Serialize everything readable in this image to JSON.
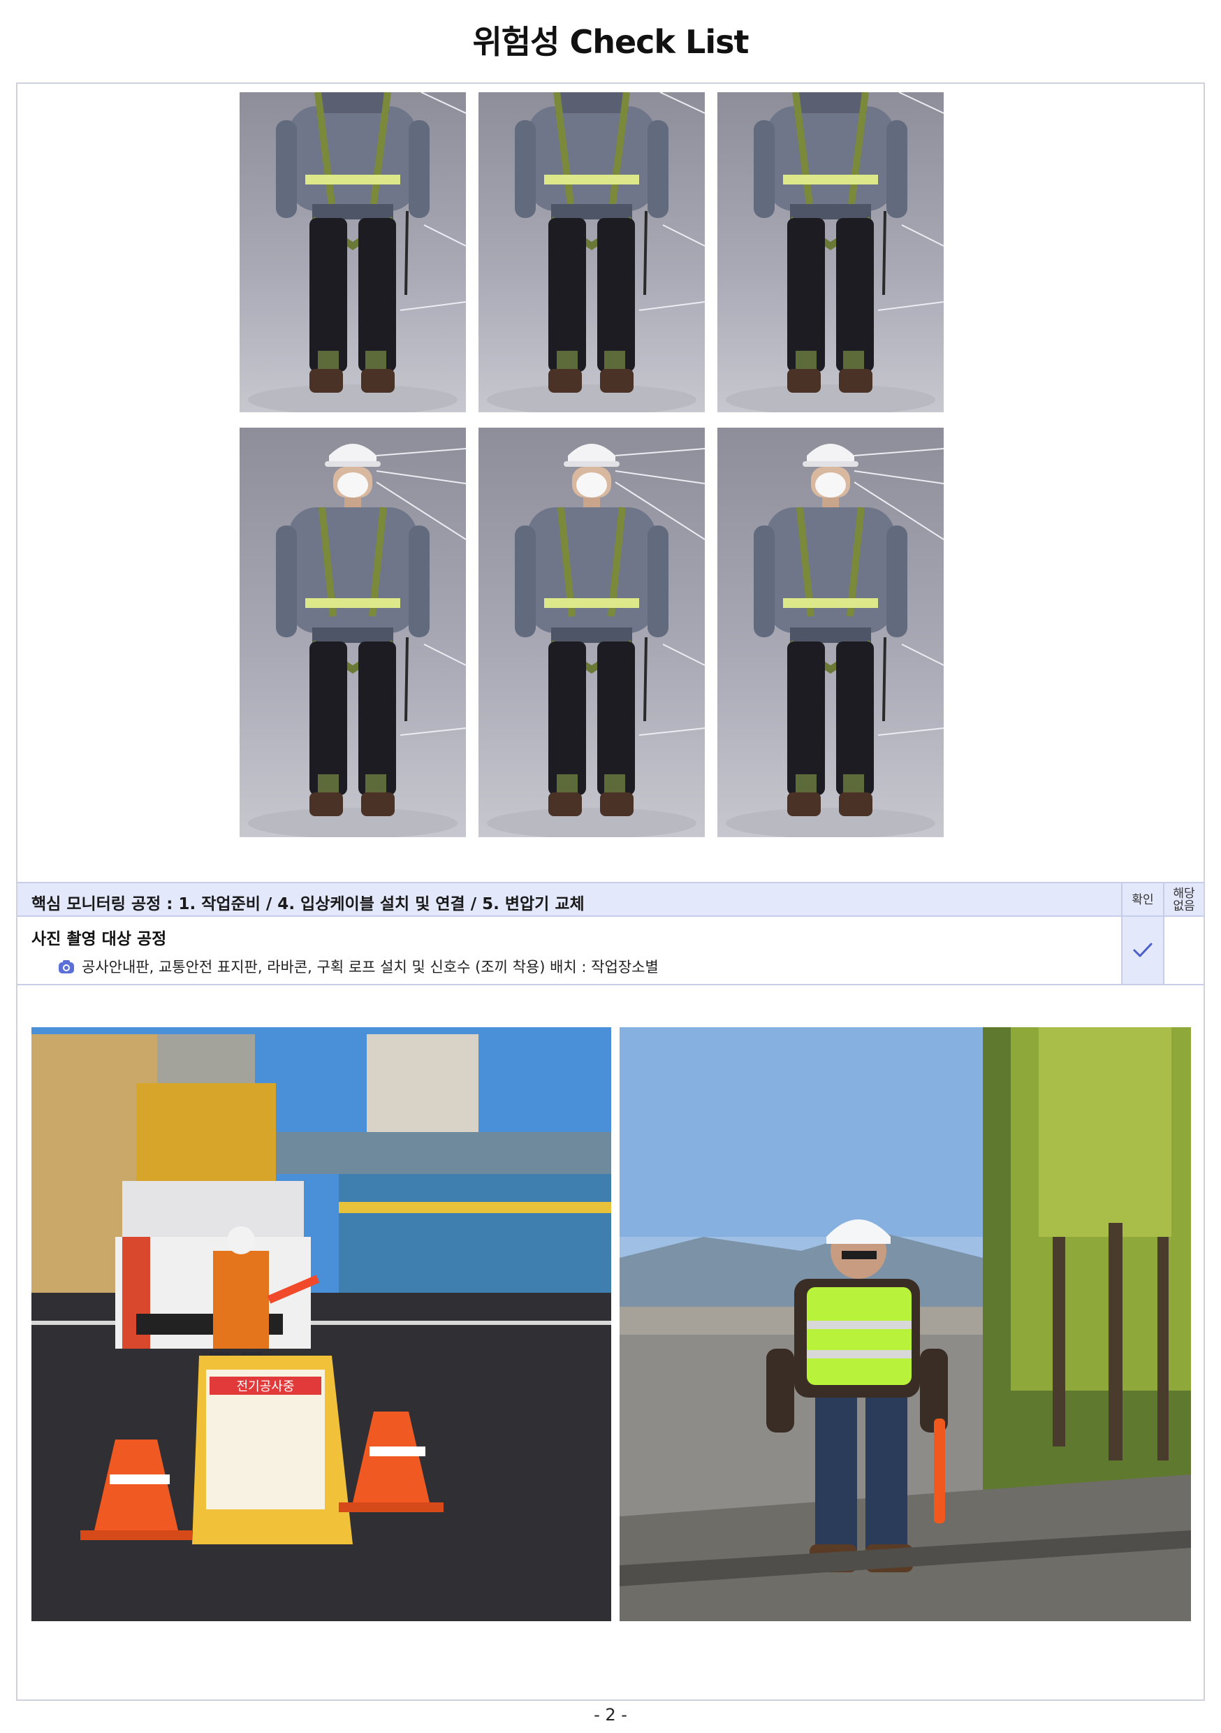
{
  "document": {
    "title": "위험성 Check List",
    "page_number": "- 2 -"
  },
  "ppe_images": {
    "rows": [
      {
        "items": [
          {
            "icon": "harness-worker"
          },
          {
            "icon": "harness-worker"
          },
          {
            "icon": "harness-worker"
          }
        ]
      },
      {
        "items": [
          {
            "icon": "helmet-mask-harness-worker"
          },
          {
            "icon": "helmet-mask-harness-worker"
          },
          {
            "icon": "helmet-mask-harness-worker"
          }
        ]
      }
    ]
  },
  "monitoring": {
    "label": "핵심 모니터링 공정 : 1. 작업준비  /  4. 입상케이블 설치 및 연결  /  5. 변압기 교체",
    "confirm_header": "확인",
    "na_header_line1": "해당",
    "na_header_line2": "없음"
  },
  "photo_section": {
    "title": "사진 촬영 대상  공정",
    "description": "공사안내판, 교통안전 표지판, 라바콘, 구획 로프 설치 및 신호수 (조끼 착용) 배치 : 작업장소별",
    "icon": "camera-icon",
    "checked": true
  },
  "site_photos": [
    {
      "icon": "roadside-worker-with-cones-photo",
      "sign_text": "전기공사중"
    },
    {
      "icon": "signalman-in-vest-photo"
    }
  ],
  "colors": {
    "header_bg": "#e3e8fb",
    "border": "#c6cde8",
    "check": "#4a5fc9",
    "camera": "#5b6fd6"
  }
}
